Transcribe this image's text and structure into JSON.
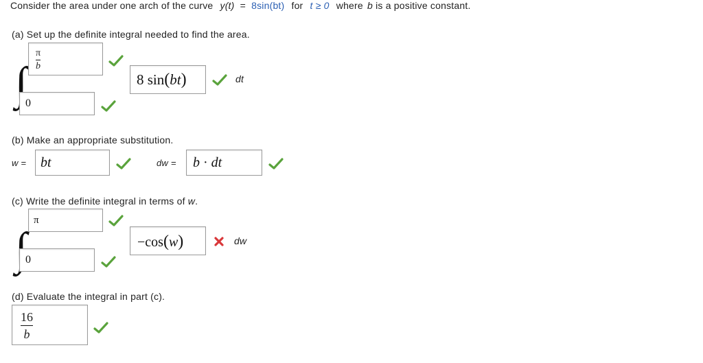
{
  "problem": {
    "intro": "Consider the area under one arch of the curve",
    "curve_lhs": "y(t)",
    "equals": "=",
    "curve_rhs": "8sin(bt)",
    "for_word": "for",
    "cond": "t ≥ 0",
    "where_text": "where",
    "b_var": "b",
    "tail": "is a positive constant."
  },
  "part_a": {
    "prompt": "(a) Set up the definite integral needed to find the area.",
    "upper_num": "π",
    "upper_den": "b",
    "lower": "0",
    "integrand_coef": "8 sin",
    "integrand_arg": "bt",
    "differential": "dt"
  },
  "part_b": {
    "prompt": "(b) Make an appropriate substitution.",
    "w_label": "w =",
    "w_value": "bt",
    "dw_label": "dw =",
    "dw_value_b": "b",
    "dw_value_dot": "·",
    "dw_value_dt": "dt"
  },
  "part_c": {
    "prompt_pre": "(c) Write the definite integral in terms of",
    "prompt_var": "w",
    "prompt_end": ".",
    "upper": "π",
    "lower": "0",
    "integrand_neg": "−cos",
    "integrand_arg": "w",
    "differential": "dw"
  },
  "part_d": {
    "prompt": "(d) Evaluate the integral in part (c).",
    "num": "16",
    "den": "b"
  },
  "colors": {
    "check": "#5aa33c",
    "cross": "#d9383a",
    "answer_blue": "#2b5fb3"
  }
}
